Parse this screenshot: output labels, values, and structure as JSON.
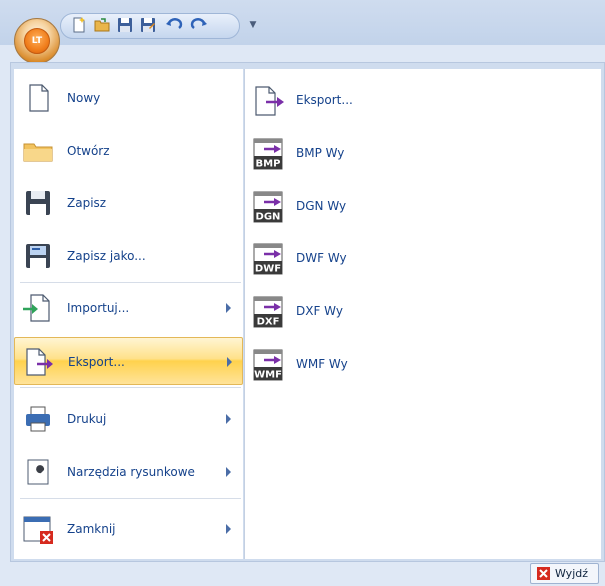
{
  "app_button": {
    "logo_text": "LT"
  },
  "qat": {
    "icons": [
      "new-icon",
      "open-icon",
      "save-icon",
      "save-as-icon",
      "undo-icon",
      "redo-icon",
      "customize-qat-icon"
    ]
  },
  "menu": {
    "left_items": [
      {
        "label": "Nowy",
        "icon": "new-document-icon",
        "has_submenu": false
      },
      {
        "label": "Otwórz",
        "icon": "open-folder-icon",
        "has_submenu": false
      },
      {
        "label": "Zapisz",
        "icon": "save-icon",
        "has_submenu": false
      },
      {
        "label": "Zapisz jako...",
        "icon": "save-as-icon",
        "has_submenu": false
      },
      {
        "label": "Importuj...",
        "icon": "import-icon",
        "has_submenu": true
      },
      {
        "label": "Eksport...",
        "icon": "export-icon",
        "has_submenu": true,
        "active": true
      },
      {
        "label": "Drukuj",
        "icon": "printer-icon",
        "has_submenu": true
      },
      {
        "label": "Narzędzia rysunkowe",
        "icon": "wrench-icon",
        "has_submenu": true
      },
      {
        "label": "Zamknij",
        "icon": "close-window-icon",
        "has_submenu": true
      }
    ],
    "submenu_items": [
      {
        "label": "Eksport...",
        "icon": "export-icon"
      },
      {
        "label": "BMP Wy",
        "badge": "BMP",
        "icon": "bmp-export-icon"
      },
      {
        "label": "DGN Wy",
        "badge": "DGN",
        "icon": "dgn-export-icon"
      },
      {
        "label": "DWF Wy",
        "badge": "DWF",
        "icon": "dwf-export-icon"
      },
      {
        "label": "DXF Wy",
        "badge": "DXF",
        "icon": "dxf-export-icon"
      },
      {
        "label": "WMF Wy",
        "badge": "WMF",
        "icon": "wmf-export-icon"
      }
    ]
  },
  "footer": {
    "exit_label": "Wyjdź"
  },
  "colors": {
    "menu_text": "#15428b",
    "accent_arrow": "#7a2fa8",
    "active_highlight": "#ffd24d",
    "exit_red": "#d62a1e"
  }
}
